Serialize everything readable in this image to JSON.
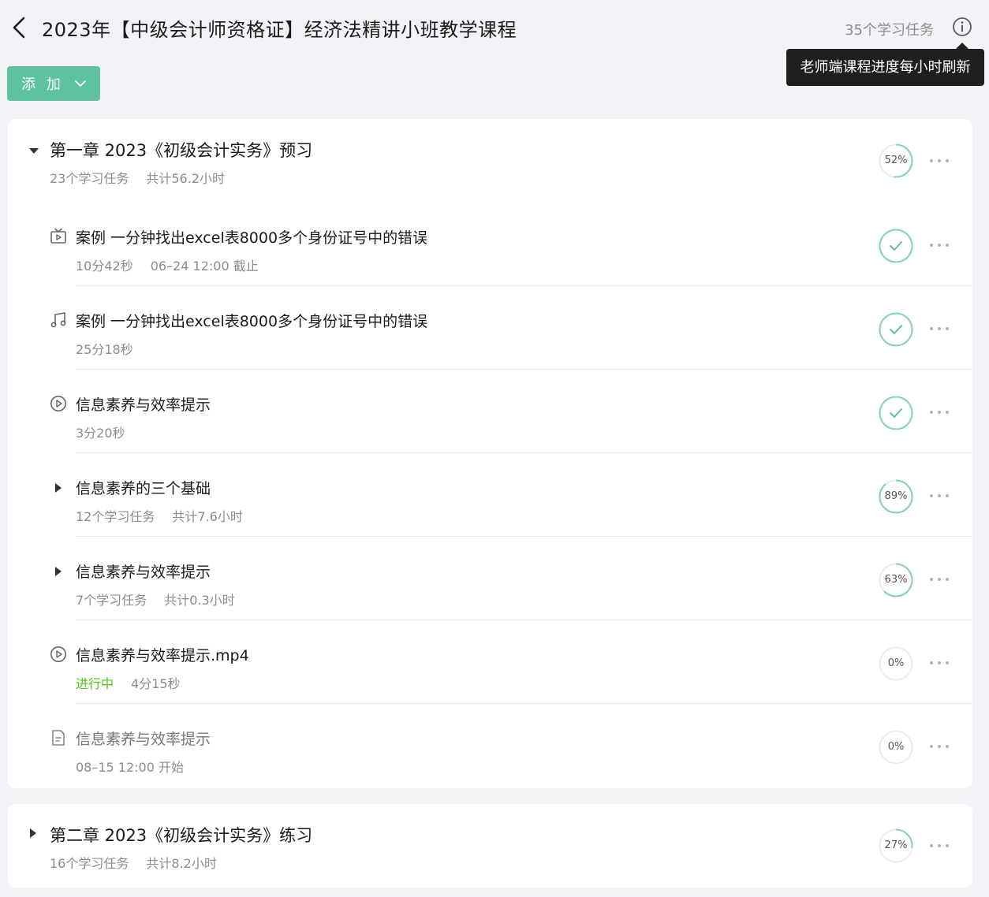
{
  "header": {
    "title": "2023年【中级会计师资格证】经济法精讲小班教学课程",
    "task_count": "35个学习任务",
    "tooltip": "老师端课程进度每小时刷新"
  },
  "toolbar": {
    "add_label": "添 加"
  },
  "chapters": [
    {
      "title": "第一章 2023《初级会计实务》预习",
      "task_count": "23个学习任务",
      "total_time": "共计56.2小时",
      "progress": 52,
      "progress_label": "52%",
      "items": [
        {
          "icon": "live-icon",
          "title": "案例 一分钟找出excel表8000多个身份证号中的错误",
          "meta1": "10分42秒",
          "meta2": "06–24 12:00 截止",
          "progress": 100,
          "status": "complete"
        },
        {
          "icon": "music-icon",
          "title": "案例 一分钟找出excel表8000多个身份证号中的错误",
          "meta1": "25分18秒",
          "progress": 100,
          "status": "complete"
        },
        {
          "icon": "play-circle-icon",
          "title": "信息素养与效率提示",
          "meta1": "3分20秒",
          "progress": 100,
          "status": "complete"
        },
        {
          "icon": "expand-icon",
          "title": "信息素养的三个基础",
          "meta1": "12个学习任务",
          "meta2": "共计7.6小时",
          "progress": 89,
          "progress_label": "89%"
        },
        {
          "icon": "expand-icon",
          "title": "信息素养与效率提示",
          "meta1": "7个学习任务",
          "meta2": "共计0.3小时",
          "progress": 63,
          "progress_label": "63%"
        },
        {
          "icon": "play-circle-icon",
          "title": "信息素养与效率提示.mp4",
          "status_label": "进行中",
          "meta1": "4分15秒",
          "progress": 0,
          "progress_label": "0%"
        },
        {
          "icon": "document-icon",
          "title": "信息素养与效率提示",
          "meta1": "08–15 12:00 开始",
          "progress": 0,
          "progress_label": "0%"
        }
      ]
    },
    {
      "title": "第二章 2023《初级会计实务》练习",
      "task_count": "16个学习任务",
      "total_time": "共计8.2小时",
      "progress": 27,
      "progress_label": "27%"
    }
  ],
  "colors": {
    "accent": "#5cc2a0",
    "progress_ring": "#7fd1b9",
    "track": "#ececec",
    "in_progress": "#52c41a",
    "tooltip_bg": "#1f1f1f"
  }
}
